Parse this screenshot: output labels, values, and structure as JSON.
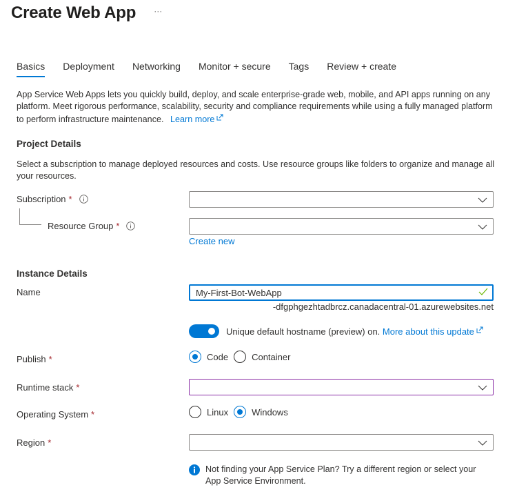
{
  "header": {
    "title": "Create Web App",
    "more_label": "···"
  },
  "tabs": [
    {
      "label": "Basics",
      "active": true
    },
    {
      "label": "Deployment",
      "active": false
    },
    {
      "label": "Networking",
      "active": false
    },
    {
      "label": "Monitor + secure",
      "active": false
    },
    {
      "label": "Tags",
      "active": false
    },
    {
      "label": "Review + create",
      "active": false
    }
  ],
  "intro": {
    "text": "App Service Web Apps lets you quickly build, deploy, and scale enterprise-grade web, mobile, and API apps running on any platform. Meet rigorous performance, scalability, security and compliance requirements while using a fully managed platform to perform infrastructure maintenance.",
    "learn_more": "Learn more"
  },
  "project": {
    "heading": "Project Details",
    "description": "Select a subscription to manage deployed resources and costs. Use resource groups like folders to organize and manage all your resources.",
    "subscription_label": "Subscription",
    "subscription_value": "",
    "resource_group_label": "Resource Group",
    "resource_group_value": "",
    "create_new": "Create new"
  },
  "instance": {
    "heading": "Instance Details",
    "name_label": "Name",
    "name_value": "My-First-Bot-WebApp",
    "hostname_suffix": "-dfgphgezhtadbrcz.canadacentral-01.azurewebsites.net",
    "toggle_text": "Unique default hostname (preview) on.",
    "toggle_on": true,
    "toggle_link": "More about this update",
    "publish_label": "Publish",
    "publish_options": [
      {
        "label": "Code",
        "checked": true
      },
      {
        "label": "Container",
        "checked": false
      }
    ],
    "runtime_label": "Runtime stack",
    "runtime_value": "",
    "os_label": "Operating System",
    "os_options": [
      {
        "label": "Linux",
        "checked": false
      },
      {
        "label": "Windows",
        "checked": true
      }
    ],
    "region_label": "Region",
    "region_value": "",
    "notice": "Not finding your App Service Plan? Try a different region or select your App Service Environment."
  },
  "required_mark": "*",
  "colors": {
    "accent": "#0078d4",
    "required": "#a4262c",
    "valid": "#6bb700",
    "focus_purple": "#8a2da5"
  }
}
